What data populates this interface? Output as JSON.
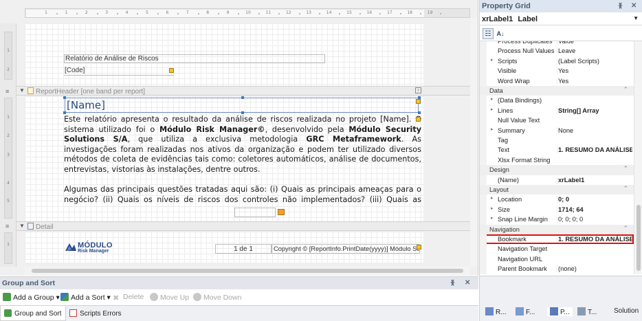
{
  "ruler": {
    "ticks": [
      "1",
      "1",
      "2",
      "3",
      "4",
      "5",
      "6",
      "7",
      "8",
      "9",
      "10",
      "11",
      "12",
      "13",
      "14",
      "15",
      "16",
      "17",
      "18",
      "19"
    ],
    "vertical_numbers": [
      "1",
      "2",
      "1",
      "2",
      "3",
      "4",
      "5",
      "1"
    ]
  },
  "page_header": {
    "title_label": "Relatório de Análise de Riscos",
    "code_label": "[Code]"
  },
  "report_header": {
    "band_label": "ReportHeader [one band per report]",
    "name_label": "[Name]",
    "paragraph1_parts": [
      {
        "t": "Este relatório apresenta o resultado da análise de riscos realizada no projeto [Name]. O sistema utilizado foi o ",
        "b": false
      },
      {
        "t": "Módulo Risk Manager©",
        "b": true
      },
      {
        "t": ", desenvolvido pela ",
        "b": false
      },
      {
        "t": "Módulo Security Solutions S/A",
        "b": true
      },
      {
        "t": ", que utiliza a exclusiva metodologia ",
        "b": false
      },
      {
        "t": "GRC Metaframework",
        "b": true
      },
      {
        "t": ". As investigações foram realizadas nos ativos da organização e podem ter utilizado diversos métodos de coleta de evidências tais como: coletores automáticos, análise de documentos, entrevistas, vistorias às instalações, dentre outros.",
        "b": false
      }
    ],
    "paragraph2": "Algumas das principais questões tratadas aqui são: (i) Quais as principais ameaças para o negócio? (ii) Quais os níveis de riscos dos controles não implementados? (iii) Quais as recomendações para"
  },
  "detail": {
    "band_label": "Detail",
    "logo_top": "MÓDULO",
    "logo_bottom": "Risk Manager",
    "page_info": "1 de 1",
    "copyright": "Copyright © [ReportInfo.PrintDate(yyyy)] Módulo Solutions"
  },
  "property_grid": {
    "title": "Property Grid",
    "pin_icon": "pin-icon",
    "close_icon": "close-icon",
    "selected_object": "xrLabel1",
    "selected_type": "Label",
    "rows": [
      {
        "name": "Process Duplicates Ta",
        "value": "Value",
        "kind": "prop"
      },
      {
        "name": "Process Null Values",
        "value": "Leave",
        "kind": "prop"
      },
      {
        "name": "Scripts",
        "value": "(Label Scripts)",
        "kind": "prop",
        "expand": true
      },
      {
        "name": "Visible",
        "value": "Yes",
        "kind": "prop"
      },
      {
        "name": "Word Wrap",
        "value": "Yes",
        "kind": "prop"
      },
      {
        "name": "Data",
        "value": "",
        "kind": "cat"
      },
      {
        "name": "(Data Bindings)",
        "value": "",
        "kind": "prop",
        "expand": true
      },
      {
        "name": "Lines",
        "value": "String[] Array",
        "kind": "prop",
        "expand": true,
        "bold": true
      },
      {
        "name": "Null Value Text",
        "value": "",
        "kind": "prop"
      },
      {
        "name": "Summary",
        "value": "None",
        "kind": "prop",
        "expand": true
      },
      {
        "name": "Tag",
        "value": "",
        "kind": "prop"
      },
      {
        "name": "Text",
        "value": "1. RESUMO DA ANÁLISE",
        "kind": "prop",
        "bold": true
      },
      {
        "name": "Xlsx Format String",
        "value": "",
        "kind": "prop"
      },
      {
        "name": "Design",
        "value": "",
        "kind": "cat"
      },
      {
        "name": "(Name)",
        "value": "xrLabel1",
        "kind": "prop",
        "bold": true
      },
      {
        "name": "Layout",
        "value": "",
        "kind": "cat"
      },
      {
        "name": "Location",
        "value": "0; 0",
        "kind": "prop",
        "expand": true,
        "bold": true
      },
      {
        "name": "Size",
        "value": "1714; 64",
        "kind": "prop",
        "expand": true,
        "bold": true
      },
      {
        "name": "Snap Line Margin",
        "value": "0; 0; 0; 0",
        "kind": "prop",
        "expand": true
      },
      {
        "name": "Navigation",
        "value": "",
        "kind": "cat"
      },
      {
        "name": "Bookmark",
        "value": "1. RESUMO DA ANÁLISE",
        "kind": "prop",
        "bold": true,
        "selected": true
      },
      {
        "name": "Navigation Target",
        "value": "",
        "kind": "prop"
      },
      {
        "name": "Navigation URL",
        "value": "",
        "kind": "prop"
      },
      {
        "name": "Parent Bookmark",
        "value": "(none)",
        "kind": "prop"
      }
    ]
  },
  "group_sort": {
    "title": "Group and Sort",
    "add_group": "Add a Group",
    "add_sort": "Add a Sort",
    "delete": "Delete",
    "move_up": "Move Up",
    "move_down": "Move Down"
  },
  "bottom_tabs": {
    "group_and_sort": "Group and Sort",
    "scripts_errors": "Scripts Errors"
  },
  "right_tabs": [
    "R...",
    "F...",
    "P...",
    "T...",
    "Solution"
  ]
}
